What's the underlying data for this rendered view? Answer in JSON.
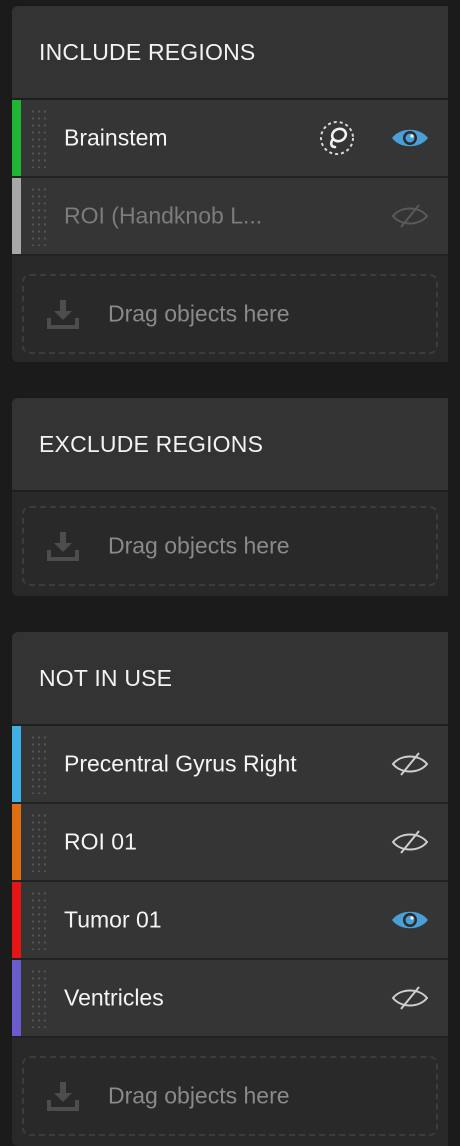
{
  "include": {
    "title": "INCLUDE REGIONS",
    "items": [
      {
        "label": "Brainstem",
        "color": "#1fb635",
        "visible": true,
        "focus_icon": "focus-lasso-icon"
      },
      {
        "label": "ROI (Handknob L...",
        "color": "#a7a7a7",
        "visible": false,
        "dimmed": true
      }
    ],
    "drop_label": "Drag objects here"
  },
  "exclude": {
    "title": "EXCLUDE REGIONS",
    "drop_label": "Drag objects here"
  },
  "not_in_use": {
    "title": "NOT IN USE",
    "items": [
      {
        "label": "Precentral Gyrus Right",
        "color": "#3fb0e6",
        "visible": false
      },
      {
        "label": "ROI 01",
        "color": "#e06d10",
        "visible": false
      },
      {
        "label": "Tumor 01",
        "color": "#e51515",
        "visible": true
      },
      {
        "label": "Ventricles",
        "color": "#6a5ccf",
        "visible": false
      }
    ],
    "drop_label": "Drag objects here"
  },
  "colors": {
    "eye_visible": "#4a9fd6",
    "eye_hidden_bright": "#cfcfcf",
    "eye_hidden_dim": "#5a5a5a"
  },
  "icons": {
    "eye_visible": "eye-icon",
    "eye_hidden": "eye-slash-icon",
    "download": "download-tray-icon"
  }
}
